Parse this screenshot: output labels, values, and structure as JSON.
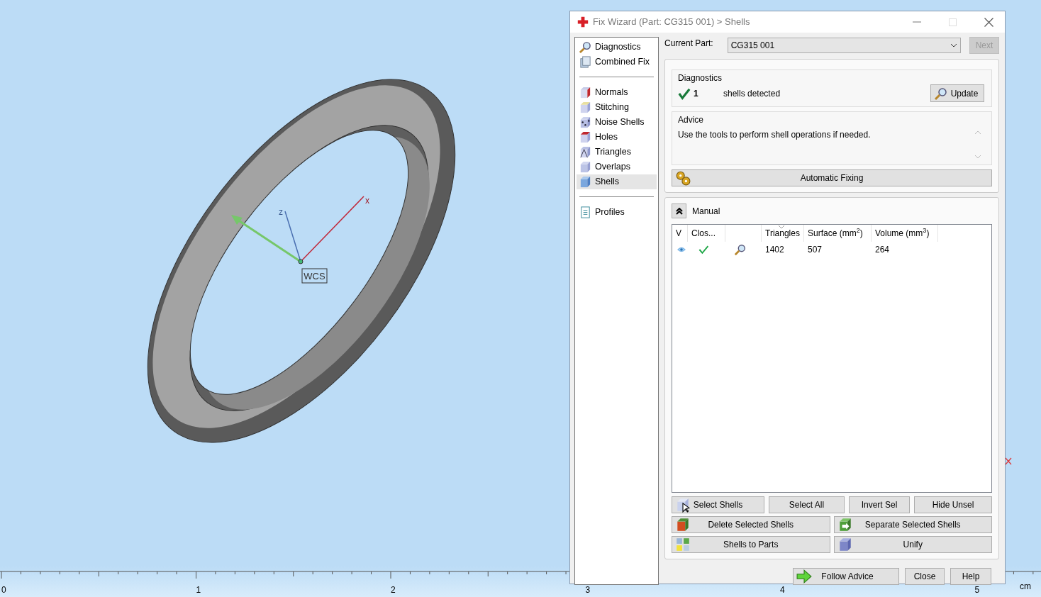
{
  "viewport": {
    "axis_labels": [
      {
        "kind": "x",
        "text": "x"
      },
      {
        "kind": "z",
        "text": "z"
      }
    ],
    "wcs_label": "WCS",
    "ruler": {
      "labels": [
        "0",
        "1",
        "2",
        "3",
        "4",
        "5"
      ],
      "unit": "cm"
    }
  },
  "window": {
    "title": "Fix Wizard (Part: CG315 001) > Shells"
  },
  "sidebar": {
    "groups": [
      [
        {
          "label": "Diagnostics",
          "selected": false
        },
        {
          "label": "Combined Fix",
          "selected": false
        }
      ],
      [
        {
          "label": "Normals",
          "selected": false
        },
        {
          "label": "Stitching",
          "selected": false
        },
        {
          "label": "Noise Shells",
          "selected": false
        },
        {
          "label": "Holes",
          "selected": false
        },
        {
          "label": "Triangles",
          "selected": false
        },
        {
          "label": "Overlaps",
          "selected": false
        },
        {
          "label": "Shells",
          "selected": true
        }
      ],
      [
        {
          "label": "Profiles",
          "selected": false
        }
      ]
    ]
  },
  "current_part": {
    "label": "Current Part:",
    "value": "CG315 001",
    "next_button": {
      "label": "Next",
      "disabled": true
    }
  },
  "diagnostics": {
    "title": "Diagnostics",
    "ok": true,
    "count": "1",
    "text": "shells detected",
    "update_button": "Update"
  },
  "advice": {
    "title": "Advice",
    "text": "Use the tools to perform shell operations if needed."
  },
  "automatic_fixing_button": "Automatic Fixing",
  "manual": {
    "title": "Manual",
    "expanded": true,
    "table": {
      "columns": [
        {
          "kind": "text",
          "label": "V"
        },
        {
          "kind": "text",
          "label": "Clos..."
        },
        {
          "kind": "blank"
        },
        {
          "kind": "text",
          "label": "Triangles",
          "sorted": true
        },
        {
          "kind": "text",
          "label": "Surface (mm$^{2}$)"
        },
        {
          "kind": "text",
          "label": "Volume (mm$^{3}$)"
        }
      ],
      "rows": [
        {
          "visible": true,
          "closed": true,
          "triangles": "1402",
          "surface": "507",
          "volume": "264"
        }
      ]
    },
    "button_rows": [
      [
        {
          "label": "Select Shells"
        },
        {
          "label": "Select All"
        },
        {
          "label": "Invert Sel"
        },
        {
          "label": "Hide Unsel"
        }
      ],
      [
        {
          "label": "Delete Selected Shells"
        },
        {
          "label": "Separate Selected Shells"
        }
      ],
      [
        {
          "label": "Shells to Parts"
        },
        {
          "label": "Unify"
        }
      ]
    ]
  },
  "footer_buttons": [
    {
      "label": "Follow Advice"
    },
    {
      "label": "Close"
    },
    {
      "label": "Help"
    }
  ]
}
